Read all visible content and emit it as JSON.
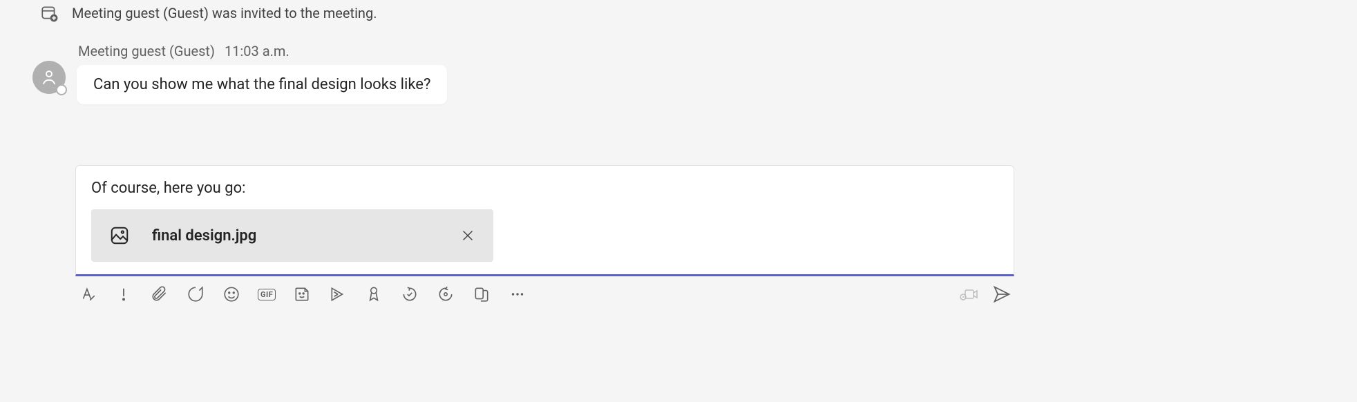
{
  "event": {
    "text": "Meeting guest (Guest) was invited to the meeting."
  },
  "message": {
    "sender": "Meeting guest (Guest)",
    "time": "11:03 a.m.",
    "body": "Can you show me what the final design looks like?"
  },
  "compose": {
    "text": "Of course, here you go:",
    "attachment": {
      "name": "final design.jpg"
    }
  },
  "toolbar": {
    "gif_label": "GIF"
  }
}
